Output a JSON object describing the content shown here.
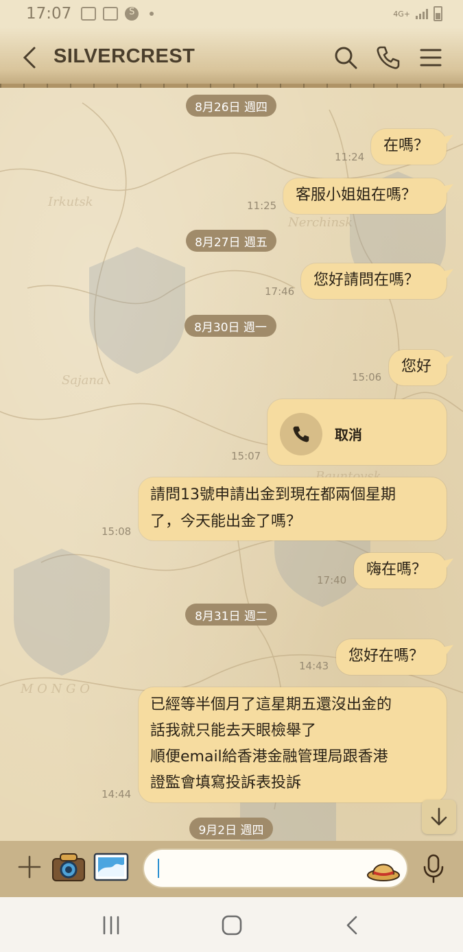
{
  "status_bar": {
    "time": "17:07",
    "network": "4G+",
    "icons": [
      "gallery-icon",
      "gmail-icon",
      "s-icon"
    ]
  },
  "header": {
    "title": "SILVERCREST",
    "icons": [
      "back-icon",
      "search-icon",
      "phone-icon",
      "menu-icon"
    ]
  },
  "messages": {
    "date_1": "8月26日 週四",
    "msg_1": "在嗎？",
    "time_1": "11:24",
    "msg_2": "客服小姐姐在嗎？",
    "time_2": "11:25",
    "date_2": "8月27日 週五",
    "msg_3": "您好請問在嗎？",
    "time_3": "17:46",
    "date_3": "8月30日 週一",
    "msg_4": "您好",
    "time_4": "15:06",
    "call_label": "取消",
    "time_5": "15:07",
    "msg_6_line1": "請問13號申請出金到現在都兩個星期",
    "msg_6_line2": "了，今天能出金了嗎？",
    "time_6": "15:08",
    "msg_7": "嗨在嗎？",
    "time_7": "17:40",
    "date_4": "8月31日 週二",
    "msg_8": "您好在嗎？",
    "time_8": "14:43",
    "msg_9_line1": "已經等半個月了這星期五還沒出金的",
    "msg_9_line2": "話我就只能去天眼檢舉了",
    "msg_9_line3": "順便email給香港金融管理局跟香港",
    "msg_9_line4": "證監會填寫投訴表投訴",
    "time_9": "14:44",
    "date_5": "9月2日 週四"
  },
  "input_bar": {
    "placeholder": "",
    "icons": [
      "plus-icon",
      "camera-icon",
      "image-icon",
      "sticker-icon",
      "mic-icon"
    ]
  },
  "nav_bar": {
    "icons": [
      "recent-apps-icon",
      "home-icon",
      "back-nav-icon"
    ]
  },
  "colors": {
    "bubble": "#f6dca0",
    "date_pill": "#a08b6a",
    "background": "#e8d9b6",
    "header": "#d9c59c"
  }
}
